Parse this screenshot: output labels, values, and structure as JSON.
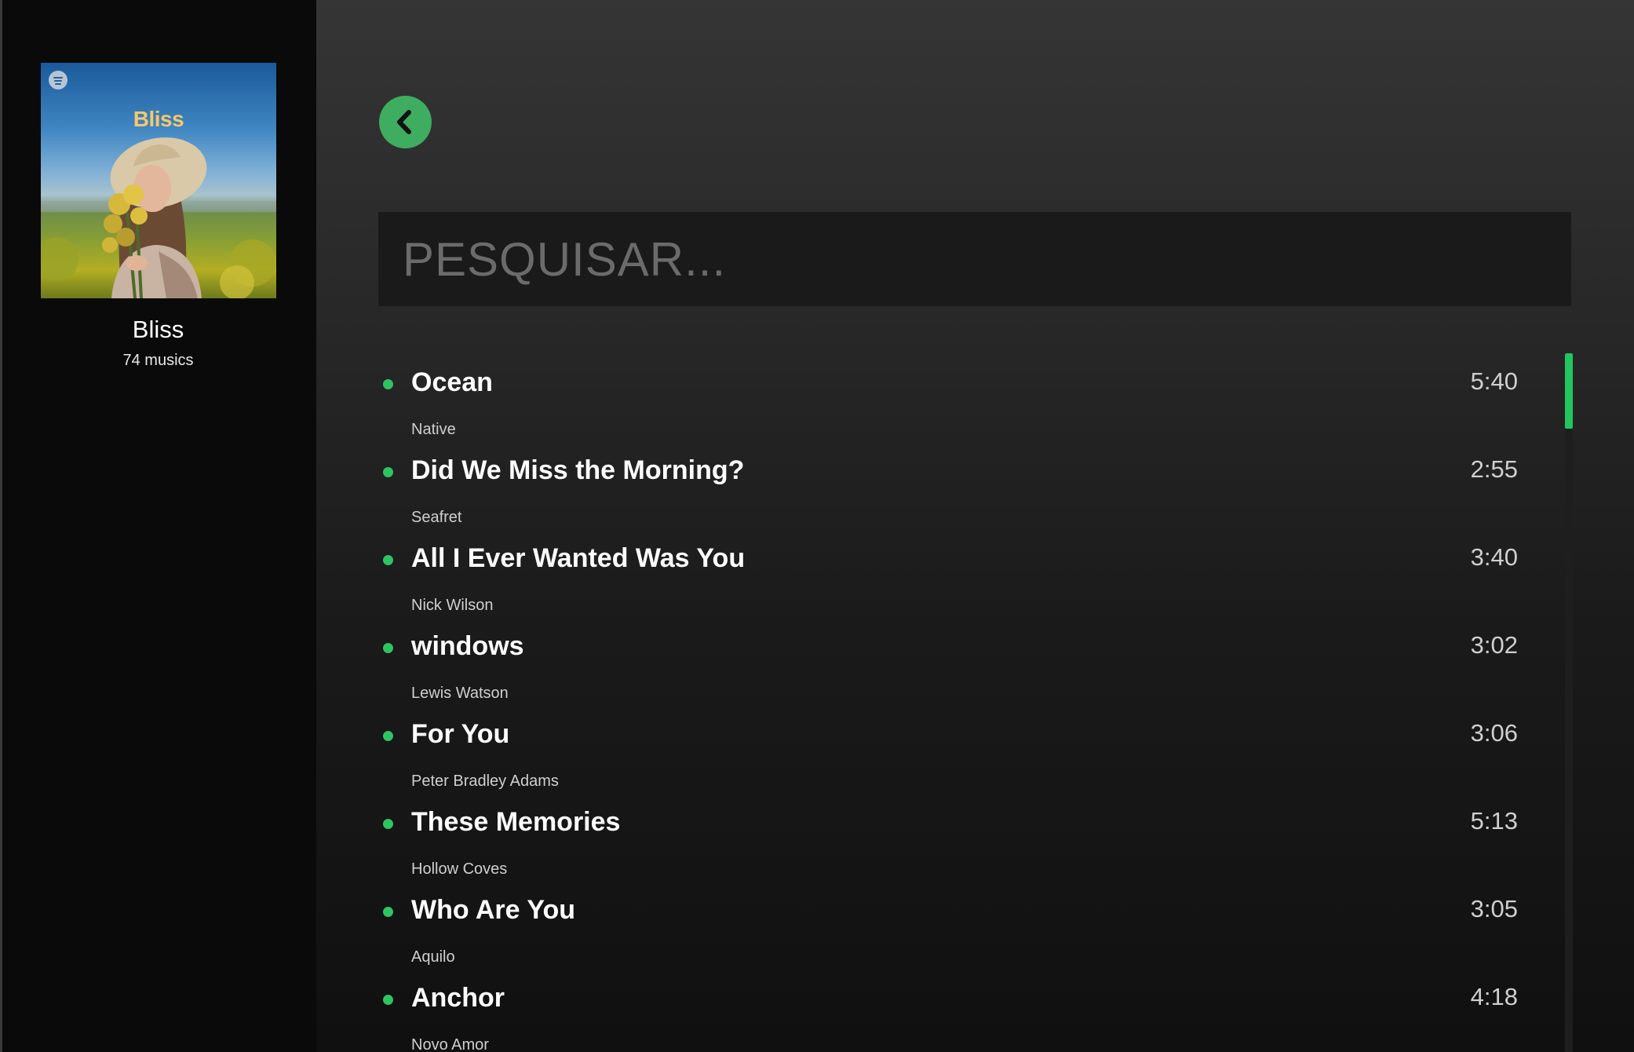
{
  "colors": {
    "accent": "#22c55e",
    "back_button": "#3ead60",
    "sidebar_bg": "#0a0a0b",
    "main_bg_top": "#353535",
    "main_bg_bottom": "#101010",
    "cover_title": "#f7c76a"
  },
  "sidebar": {
    "cover_title": "Bliss",
    "cover_badge_icon": "spotify-logo-icon",
    "playlist_name": "Bliss",
    "playlist_count": "74 musics"
  },
  "header": {
    "back_icon": "chevron-left-icon"
  },
  "search": {
    "placeholder": "PESQUISAR...",
    "value": ""
  },
  "tracks": [
    {
      "title": "Ocean",
      "artist": "Native",
      "duration": "5:40"
    },
    {
      "title": "Did We Miss the Morning?",
      "artist": "Seafret",
      "duration": "2:55"
    },
    {
      "title": "All I Ever Wanted Was You",
      "artist": "Nick Wilson",
      "duration": "3:40"
    },
    {
      "title": "windows",
      "artist": "Lewis Watson",
      "duration": "3:02"
    },
    {
      "title": "For You",
      "artist": "Peter Bradley Adams",
      "duration": "3:06"
    },
    {
      "title": "These Memories",
      "artist": "Hollow Coves",
      "duration": "5:13"
    },
    {
      "title": "Who Are You",
      "artist": "Aquilo",
      "duration": "3:05"
    },
    {
      "title": "Anchor",
      "artist": "Novo Amor",
      "duration": "4:18"
    }
  ]
}
